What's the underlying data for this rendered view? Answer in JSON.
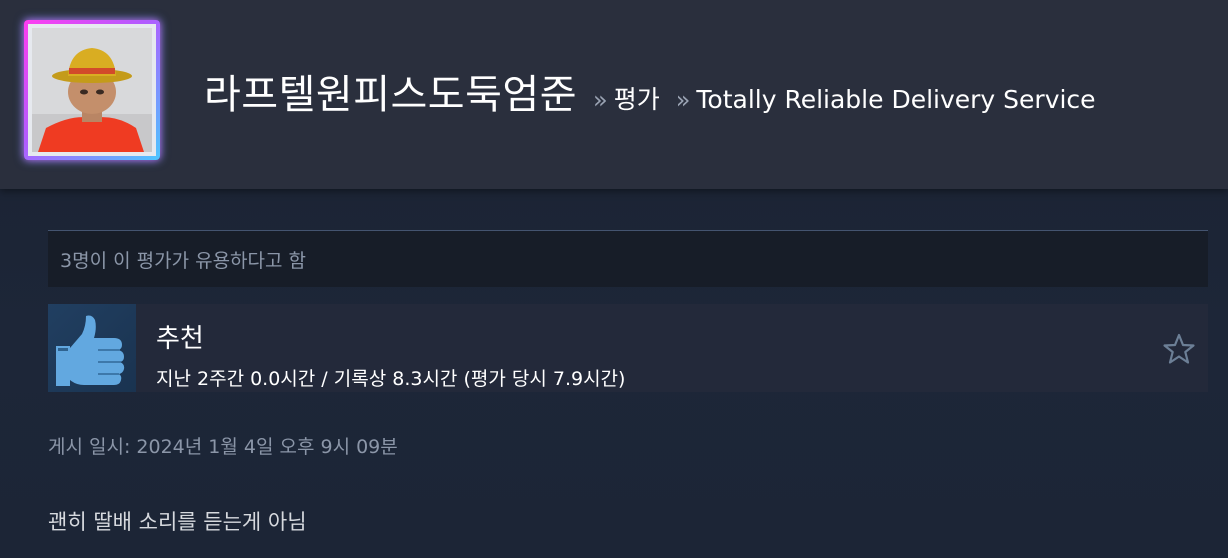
{
  "header": {
    "username": "라프텔원피스도둑엄준",
    "separator": "»",
    "section_label": "평가",
    "game_title": "Totally Reliable Delivery Service"
  },
  "review": {
    "helpful_text": "3명이 이 평가가 유용하다고 함",
    "recommendation": "추천",
    "hours_text": "지난 2주간 0.0시간 / 기록상 8.3시간 (평가 당시 7.9시간)",
    "posted_text": "게시 일시: 2024년 1월 4일 오후 9시 09분",
    "body": "괜히 딸배 소리를 듣는게 아님"
  },
  "icons": {
    "thumb": "thumbs-up-icon",
    "star": "star-outline-icon"
  },
  "colors": {
    "header_bg": "#2a2f3d",
    "page_bg": "#1c2536",
    "thumb_blue": "#62a8e0",
    "avatar_frame_pink": "#ff3df0",
    "avatar_frame_cyan": "#4cc6ff"
  }
}
